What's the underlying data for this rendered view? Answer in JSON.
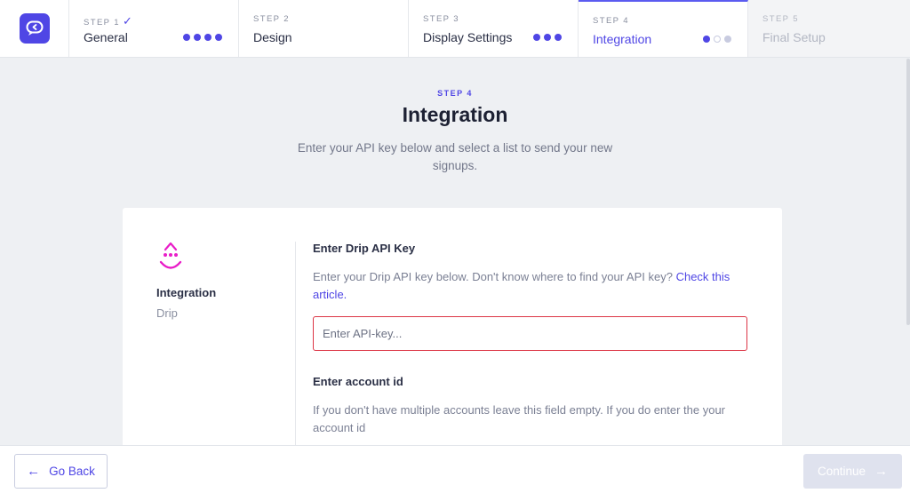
{
  "app": {
    "logo_icon": "chat-bubble-back-icon",
    "accent_color": "#4f46e5"
  },
  "steps": [
    {
      "label": "STEP 1",
      "name": "General",
      "completed_mark": "✓",
      "dots": 4
    },
    {
      "label": "STEP 2",
      "name": "Design",
      "dots": 0
    },
    {
      "label": "STEP 3",
      "name": "Display Settings",
      "dots": 3
    },
    {
      "label": "STEP 4",
      "name": "Integration",
      "dots_progress": "1 of 3",
      "active": true
    },
    {
      "label": "STEP 5",
      "name": "Final Setup",
      "disabled": true
    }
  ],
  "header": {
    "kicker": "STEP 4",
    "title": "Integration",
    "subtitle": "Enter your API key below and select a list to send your new signups."
  },
  "integration": {
    "icon": "drip-logo-icon",
    "title": "Integration",
    "provider": "Drip"
  },
  "api_key": {
    "title": "Enter Drip API Key",
    "desc": "Enter your Drip API key below. Don't know where to find your API key? ",
    "link": "Check this article.",
    "placeholder": "Enter API-key...",
    "value": ""
  },
  "account_id": {
    "title": "Enter account id",
    "desc": "If you don't have multiple accounts leave this field empty. If you do enter the your account id"
  },
  "footer": {
    "back_label": "Go Back",
    "continue_label": "Continue"
  }
}
